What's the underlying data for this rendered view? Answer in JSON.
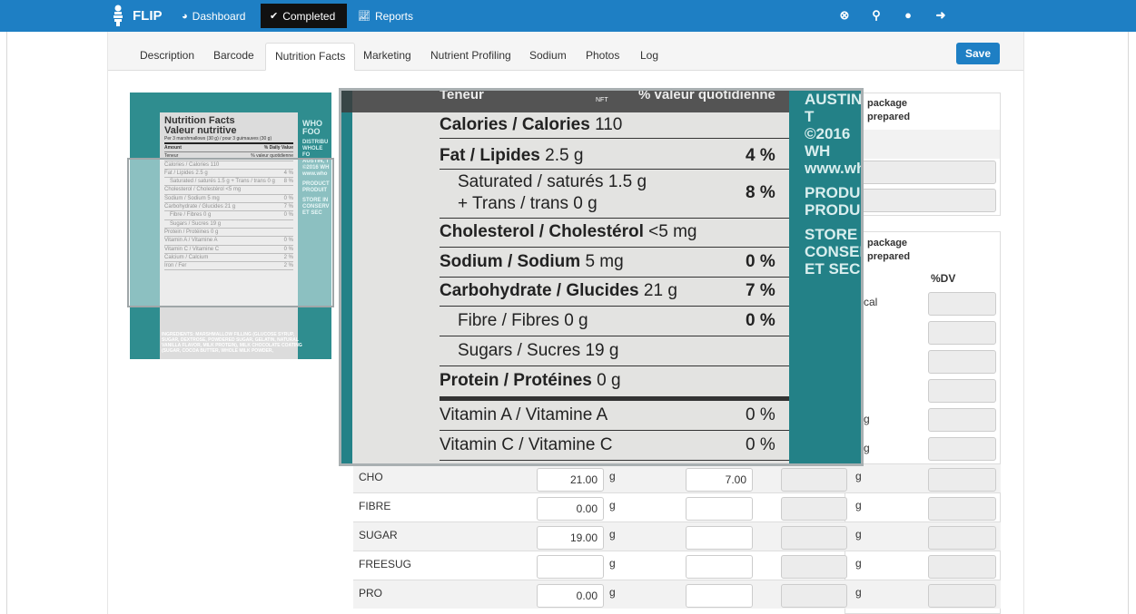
{
  "navbar": {
    "brand": "FLIP",
    "links": [
      {
        "label": "Dashboard",
        "icon": "dashboard-icon"
      },
      {
        "label": "Completed",
        "icon": "check-icon"
      },
      {
        "label": "Reports",
        "icon": "chart-icon"
      }
    ],
    "right_icons": [
      "close-circle-icon",
      "search-icon",
      "user-icon",
      "logout-icon"
    ]
  },
  "tabs": [
    "Description",
    "Barcode",
    "Nutrition Facts",
    "Marketing",
    "Nutrient Profiling",
    "Sodium",
    "Photos",
    "Log"
  ],
  "active_tab": "Nutrition Facts",
  "save_label": "Save",
  "panels": {
    "top_title_1": "package",
    "top_title_2": "prepared",
    "mid_title_1": "package",
    "mid_title_2": "prepared",
    "dv_header": "%DV",
    "cal_fragment": "cal",
    "g_fragment": "g"
  },
  "nutrient_rows": [
    {
      "name": "CHO",
      "amount": "21.00",
      "unit": "g",
      "dv": "7.00",
      "unit2": "g"
    },
    {
      "name": "FIBRE",
      "amount": "0.00",
      "unit": "g",
      "dv": "",
      "unit2": "g"
    },
    {
      "name": "SUGAR",
      "amount": "19.00",
      "unit": "g",
      "dv": "",
      "unit2": "g"
    },
    {
      "name": "FREESUG",
      "amount": "",
      "unit": "g",
      "dv": "",
      "unit2": "g"
    },
    {
      "name": "PRO",
      "amount": "0.00",
      "unit": "g",
      "dv": "",
      "unit2": "g"
    }
  ],
  "zoom_label": {
    "header_left": "Teneur",
    "header_mid": "NFT",
    "header_right": "% valeur quotidienne",
    "lines": [
      {
        "bold": "Calories / Calories",
        "rest": " 110",
        "pct": ""
      },
      {
        "bold": "Fat / Lipides",
        "rest": " 2.5 g",
        "pct": "4 %"
      },
      {
        "bold": "",
        "rest": "Saturated / saturés 1.5 g",
        "pct": "8 %"
      },
      {
        "bold": "",
        "rest": "+ Trans / trans 0 g",
        "pct": ""
      },
      {
        "bold": "Cholesterol / Cholestérol",
        "rest": " <5 mg",
        "pct": ""
      },
      {
        "bold": "Sodium / Sodium",
        "rest": " 5 mg",
        "pct": "0 %"
      },
      {
        "bold": "Carbohydrate / Glucides",
        "rest": " 21 g",
        "pct": "7 %"
      },
      {
        "bold": "",
        "rest": "Fibre / Fibres 0 g",
        "pct": "0 %"
      },
      {
        "bold": "",
        "rest": "Sugars / Sucres 19 g",
        "pct": ""
      },
      {
        "bold": "Protein / Protéines",
        "rest": " 0 g",
        "pct": ""
      },
      {
        "bold": "",
        "rest": "Vitamin A / Vitamine A",
        "pct": "0 %"
      },
      {
        "bold": "",
        "rest": "Vitamin C / Vitamine C",
        "pct": "0 %"
      }
    ],
    "side_text": [
      "AUSTIN, T",
      "©2016 WH",
      "www.who",
      "",
      "PRODUCT",
      "PRODUIT",
      "",
      "STORE IN",
      "CONSERV",
      "ET SEC"
    ]
  },
  "thumb_label": {
    "title1": "Nutrition Facts",
    "title2": "Valeur nutritive",
    "serving": "Per 3 marshmallows (30 g) / pour 3 guimauves (30 g)",
    "amount": "Amount",
    "dv": "% Daily Value",
    "teneur": "Teneur",
    "vq": "% valeur quotidienne",
    "rows": [
      {
        "l": "Calories / Calories 110",
        "r": ""
      },
      {
        "l": "Fat / Lipides 2.5 g",
        "r": "4 %"
      },
      {
        "l": "Saturated / saturés 1.5 g + Trans / trans 0 g",
        "r": "8 %"
      },
      {
        "l": "Cholesterol / Cholestérol <5 mg",
        "r": ""
      },
      {
        "l": "Sodium / Sodium 5 mg",
        "r": "0 %"
      },
      {
        "l": "Carbohydrate / Glucides 21 g",
        "r": "7 %"
      },
      {
        "l": "Fibre / Fibres 0 g",
        "r": "0 %"
      },
      {
        "l": "Sugars / Sucres 19 g",
        "r": ""
      },
      {
        "l": "Protein / Protéines 0 g",
        "r": ""
      },
      {
        "l": "Vitamin A / Vitamine A",
        "r": "0 %"
      },
      {
        "l": "Vitamin C / Vitamine C",
        "r": "0 %"
      },
      {
        "l": "Calcium / Calcium",
        "r": "2 %"
      },
      {
        "l": "Iron / Fer",
        "r": "2 %"
      }
    ],
    "ingredients": "INGREDIENTS: MARSHMALLOW FILLING (GLUCOSE SYRUP, SUGAR, DEXTROSE, POWDERED SUGAR, GELATIN, NATURAL VANILLA FLAVOR, MILK PROTEIN), MILK CHOCOLATE COATING (SUGAR, COCOA BUTTER, WHOLE MILK POWDER,",
    "side": [
      "WHO",
      "FOO",
      "",
      "DISTRIBU",
      "WHOLE FO",
      "AUSTIN, T",
      "©2016 WH",
      "www.who",
      "",
      "PRODUCT",
      "PRODUIT",
      "",
      "STORE IN",
      "CONSERV",
      "ET SEC"
    ]
  },
  "colors": {
    "navbar": "#1e7fc4",
    "active_nav": "#111111",
    "save_button": "#1e7fc4",
    "package_teal": "#238187"
  }
}
